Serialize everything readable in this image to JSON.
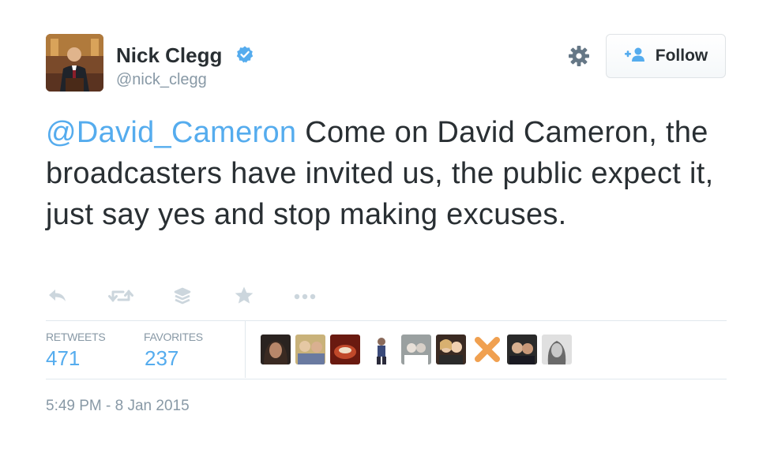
{
  "user": {
    "name": "Nick Clegg",
    "handle": "@nick_clegg"
  },
  "follow_label": "Follow",
  "tweet": {
    "mention": "@David_Cameron",
    "text": " Come on David Cameron, the broadcasters have invited us, the public expect it, just say yes and stop making excuses."
  },
  "stats": {
    "retweets_label": "RETWEETS",
    "retweets_count": "471",
    "favorites_label": "FAVORITES",
    "favorites_count": "237"
  },
  "timestamp": "5:49 PM - 8 Jan 2015",
  "colors": {
    "accent": "#55acee",
    "text": "#292f33",
    "muted": "#8899a6",
    "icon": "#ccd6dd",
    "border": "#e1e8ed"
  }
}
